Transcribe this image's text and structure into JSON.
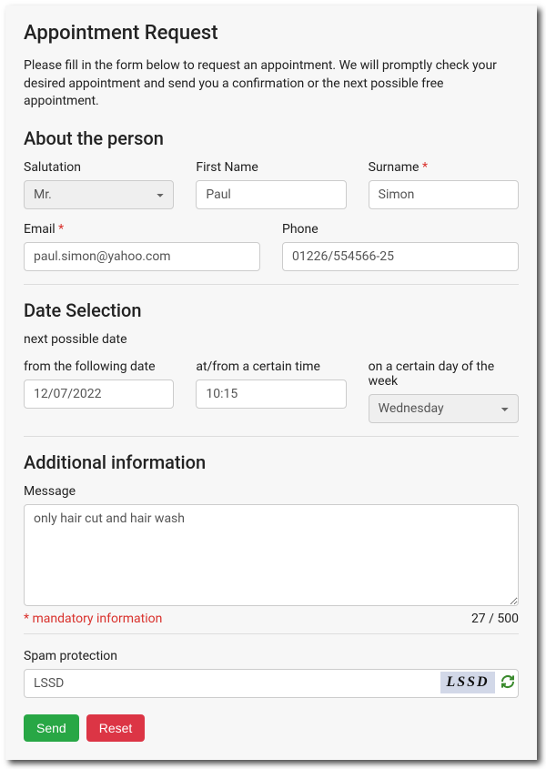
{
  "title": "Appointment Request",
  "intro": "Please fill in the form below to request an appointment. We will promptly check your desired appointment and send you a confirmation or the next possible free appointment.",
  "person": {
    "heading": "About the person",
    "salutation_label": "Salutation",
    "salutation_value": "Mr.",
    "firstname_label": "First Name",
    "firstname_value": "Paul",
    "surname_label": "Surname",
    "surname_value": "Simon",
    "email_label": "Email",
    "email_value": "paul.simon@yahoo.com",
    "phone_label": "Phone",
    "phone_value": "01226/554566-25"
  },
  "date": {
    "heading": "Date Selection",
    "subtext": "next possible date",
    "from_date_label": "from the following date",
    "from_date_value": "12/07/2022",
    "time_label": "at/from a certain time",
    "time_value": "10:15",
    "day_label": "on a certain day of the week",
    "day_value": "Wednesday"
  },
  "additional": {
    "heading": "Additional information",
    "message_label": "Message",
    "message_value": "only hair cut and hair wash",
    "mandatory_text": "* mandatory information",
    "counter": "27 / 500"
  },
  "spam": {
    "label": "Spam protection",
    "value": "LSSD",
    "captcha_text": "LSSD"
  },
  "buttons": {
    "send": "Send",
    "reset": "Reset"
  },
  "marker": "*"
}
